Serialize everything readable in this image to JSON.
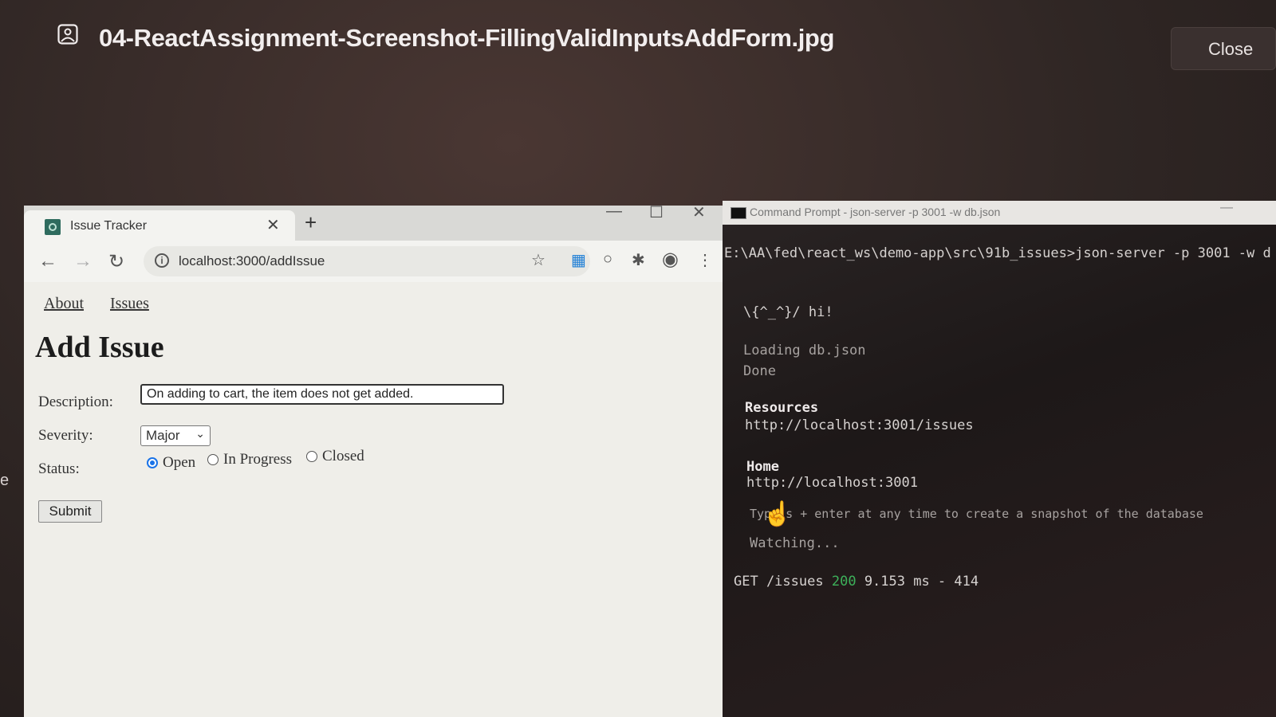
{
  "viewer": {
    "file_name": "04-ReactAssignment-Screenshot-FillingValidInputsAddForm.jpg",
    "close_label": "Close",
    "left_strip_letter": "e"
  },
  "browser": {
    "tab_title": "Issue Tracker",
    "tab_close": "✕",
    "new_tab": "+",
    "url": "localhost:3000/addIssue",
    "window_controls": {
      "minimize": "—",
      "maximize": "☐",
      "close": "✕"
    }
  },
  "page": {
    "nav": [
      "About",
      "Issues"
    ],
    "heading": "Add Issue",
    "form": {
      "description_label": "Description:",
      "description_value": "On adding to cart, the item does not get added.",
      "severity_label": "Severity:",
      "severity_value": "Major",
      "status_label": "Status:",
      "status_options": [
        "Open",
        "In Progress",
        "Closed"
      ],
      "status_selected": "Open",
      "submit_label": "Submit"
    }
  },
  "terminal": {
    "title": "Command Prompt - json-server -p 3001 -w db.json",
    "prompt_line": "E:\\AA\\fed\\react_ws\\demo-app\\src\\91b_issues>json-server -p 3001 -w d",
    "hi_line": "\\{^_^}/ hi!",
    "loading_line": "Loading db.json",
    "done_line": "Done",
    "resources_heading": "Resources",
    "resources_url": "http://localhost:3001/issues",
    "home_heading": "Home",
    "home_url": "http://localhost:3001",
    "snapshot_hint": "Type s + enter at any time to create a snapshot of the database",
    "watching_line": "Watching...",
    "request_log": {
      "method_path": "GET /issues",
      "status": "200",
      "timing": "9.153 ms - 414"
    }
  }
}
